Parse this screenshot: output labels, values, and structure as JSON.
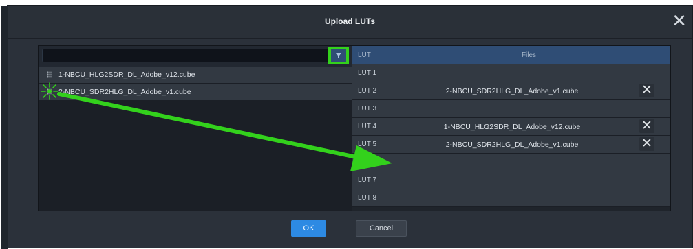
{
  "dialog": {
    "title": "Upload LUTs",
    "close_icon": "close-icon"
  },
  "search": {
    "value": "",
    "placeholder": ""
  },
  "filter": {
    "icon": "filter-icon"
  },
  "files": [
    {
      "name": "1-NBCU_HLG2SDR_DL_Adobe_v12.cube",
      "icon": "drag-handle-icon"
    },
    {
      "name": "2-NBCU_SDR2HLG_DL_Adobe_v1.cube",
      "icon": "drag-handle-icon"
    }
  ],
  "table": {
    "columns": [
      "LUT",
      "Files"
    ],
    "rows": [
      {
        "lut": "LUT 1",
        "file": ""
      },
      {
        "lut": "LUT 2",
        "file": "2-NBCU_SDR2HLG_DL_Adobe_v1.cube"
      },
      {
        "lut": "LUT 3",
        "file": ""
      },
      {
        "lut": "LUT 4",
        "file": "1-NBCU_HLG2SDR_DL_Adobe_v12.cube"
      },
      {
        "lut": "LUT 5",
        "file": "2-NBCU_SDR2HLG_DL_Adobe_v1.cube"
      },
      {
        "lut": "",
        "file": ""
      },
      {
        "lut": "LUT 7",
        "file": ""
      },
      {
        "lut": "LUT 8",
        "file": ""
      }
    ]
  },
  "buttons": {
    "ok": "OK",
    "cancel": "Cancel"
  },
  "colors": {
    "accent": "#2d8ae3",
    "header_blue": "#2f4d75",
    "highlight_green": "#33d11c",
    "dialog_bg": "#2b313a"
  }
}
